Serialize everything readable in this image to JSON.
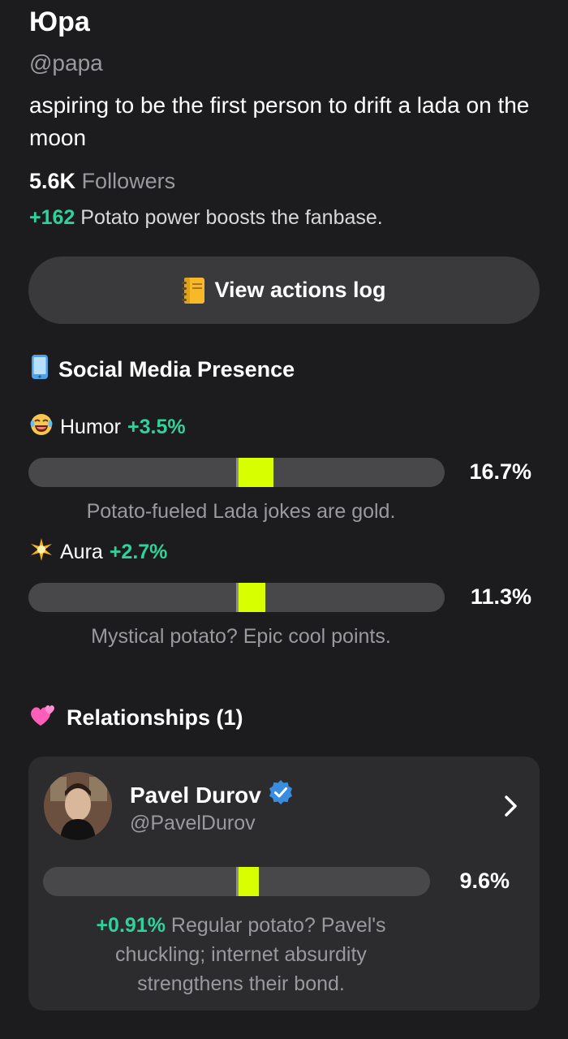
{
  "profile": {
    "name": "Юра",
    "handle": "@papa",
    "bio": "aspiring to be the first person to drift a lada on the moon",
    "followers_count": "5.6K",
    "followers_label": "Followers",
    "boost_value": "+162",
    "boost_text": "Potato power boosts the fanbase."
  },
  "actions": {
    "label": "View actions log"
  },
  "social": {
    "title": "Social Media Presence",
    "metrics": [
      {
        "icon": "laughing-face-icon",
        "label": "Humor",
        "delta": "+3.5%",
        "value_text": "16.7%",
        "value": 16.7,
        "gain": 3.5,
        "description": "Potato-fueled Lada jokes are gold."
      },
      {
        "icon": "sparkle-icon",
        "label": "Aura",
        "delta": "+2.7%",
        "value_text": "11.3%",
        "value": 11.3,
        "gain": 2.7,
        "description": "Mystical potato?  Epic cool points."
      }
    ]
  },
  "relationships": {
    "title": "Relationships (1)",
    "items": [
      {
        "name": "Pavel Durov",
        "handle": "@PavelDurov",
        "verified": true,
        "value_text": "9.6%",
        "value": 9.6,
        "delta": "+0.91%",
        "description": "Regular potato? Pavel's chuckling; internet absurdity strengthens their bond."
      }
    ]
  },
  "colors": {
    "background": "#1c1c1e",
    "accent_green": "#2fd39a",
    "bar_fill": "#d8ff00",
    "track": "#48484a",
    "button": "#3a3a3c",
    "card": "#2c2c2e",
    "verified_blue": "#3a8dde"
  }
}
